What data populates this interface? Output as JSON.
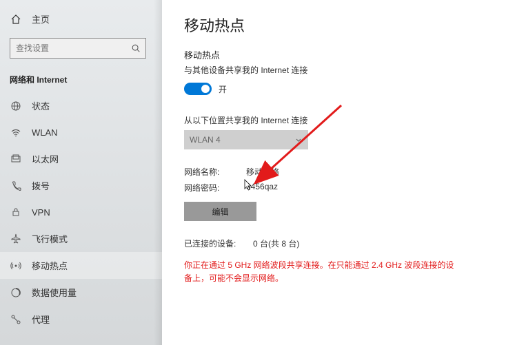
{
  "sidebar": {
    "home_label": "主页",
    "search_placeholder": "查找设置",
    "category_label": "网络和 Internet",
    "items": [
      {
        "label": "状态",
        "icon": "globe-icon"
      },
      {
        "label": "WLAN",
        "icon": "wifi-icon"
      },
      {
        "label": "以太网",
        "icon": "ethernet-icon"
      },
      {
        "label": "拨号",
        "icon": "dialup-icon"
      },
      {
        "label": "VPN",
        "icon": "vpn-icon"
      },
      {
        "label": "飞行模式",
        "icon": "airplane-icon"
      },
      {
        "label": "移动热点",
        "icon": "hotspot-icon"
      },
      {
        "label": "数据使用量",
        "icon": "data-usage-icon"
      },
      {
        "label": "代理",
        "icon": "proxy-icon"
      }
    ]
  },
  "main": {
    "page_title": "移动热点",
    "section1_title": "移动热点",
    "section1_sub": "与其他设备共享我的 Internet 连接",
    "toggle_state": "开",
    "share_from_label": "从以下位置共享我的 Internet 连接",
    "share_from_value": "WLAN 4",
    "network_name_label": "网络名称:",
    "network_name_value": "移动网络",
    "network_password_label": "网络密码:",
    "network_password_value": "  3456qaz",
    "edit_button": "编辑",
    "connected_label": "已连接的设备:",
    "connected_value": "0 台(共 8 台)",
    "warning_text": "你正在通过 5 GHz 网络波段共享连接。在只能通过 2.4 GHz 波段连接的设备上，可能不会显示网络。"
  }
}
